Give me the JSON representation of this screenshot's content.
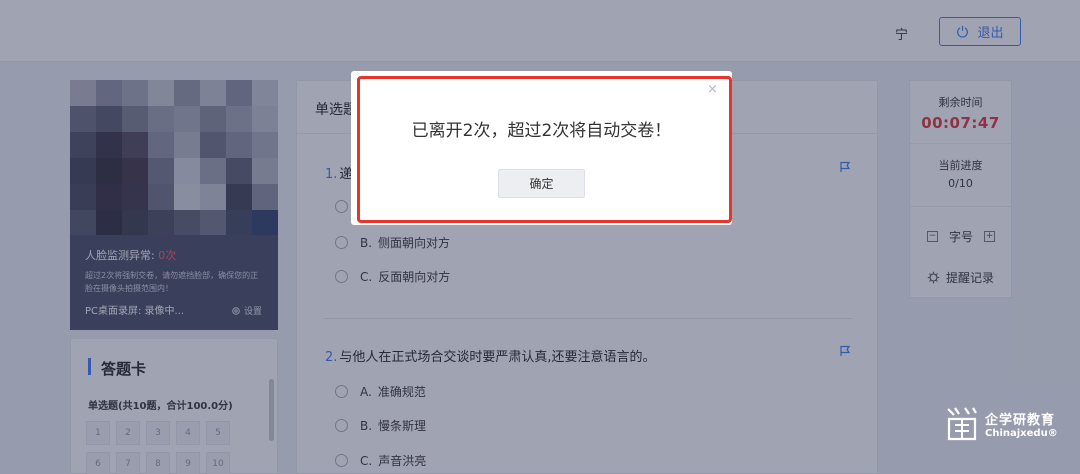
{
  "header": {
    "user_name": "宁",
    "exit_label": "退出"
  },
  "camera": {
    "face_alert_label": "人脸监测异常:",
    "face_alert_count": "0次",
    "note": "超过2次将强制交卷，请勿遮挡脸部，确保您的正脸在摄像头拍摄范围内！",
    "screen_record": "PC桌面录屏: 录像中...",
    "settings_label": "设置"
  },
  "answer_card": {
    "title": "答题卡",
    "subtitle": "单选题(共10题，合计100.0分)",
    "numbers": [
      "1",
      "2",
      "3",
      "4",
      "5",
      "6",
      "7",
      "8",
      "9",
      "10"
    ]
  },
  "main": {
    "section_title": "单选题",
    "questions": [
      {
        "number": "1.",
        "text": "递",
        "options": [
          {
            "letter": "A.",
            "text": ""
          },
          {
            "letter": "B.",
            "text": "侧面朝向对方"
          },
          {
            "letter": "C.",
            "text": "反面朝向对方"
          }
        ]
      },
      {
        "number": "2.",
        "text": "与他人在正式场合交谈时要严肃认真,还要注意语言的。",
        "options": [
          {
            "letter": "A.",
            "text": "准确规范"
          },
          {
            "letter": "B.",
            "text": "慢条斯理"
          },
          {
            "letter": "C.",
            "text": "声音洪亮"
          }
        ]
      }
    ]
  },
  "right_panel": {
    "time_label": "剩余时间",
    "time_value": "00:07:47",
    "progress_label": "当前进度",
    "progress_value": "0/10",
    "font_label": "字号",
    "font_minus": "−",
    "font_plus": "+",
    "remind_label": "提醒记录"
  },
  "modal": {
    "message": "已离开2次，超过2次将自动交卷！",
    "ok_label": "确定",
    "close_icon": "×"
  },
  "watermark": {
    "cn": "企学研教育",
    "en": "Chinajxedu®"
  },
  "colors": {
    "accent": "#3e7bf2",
    "timer": "#e0323a",
    "highlight_border": "#e8352b"
  }
}
